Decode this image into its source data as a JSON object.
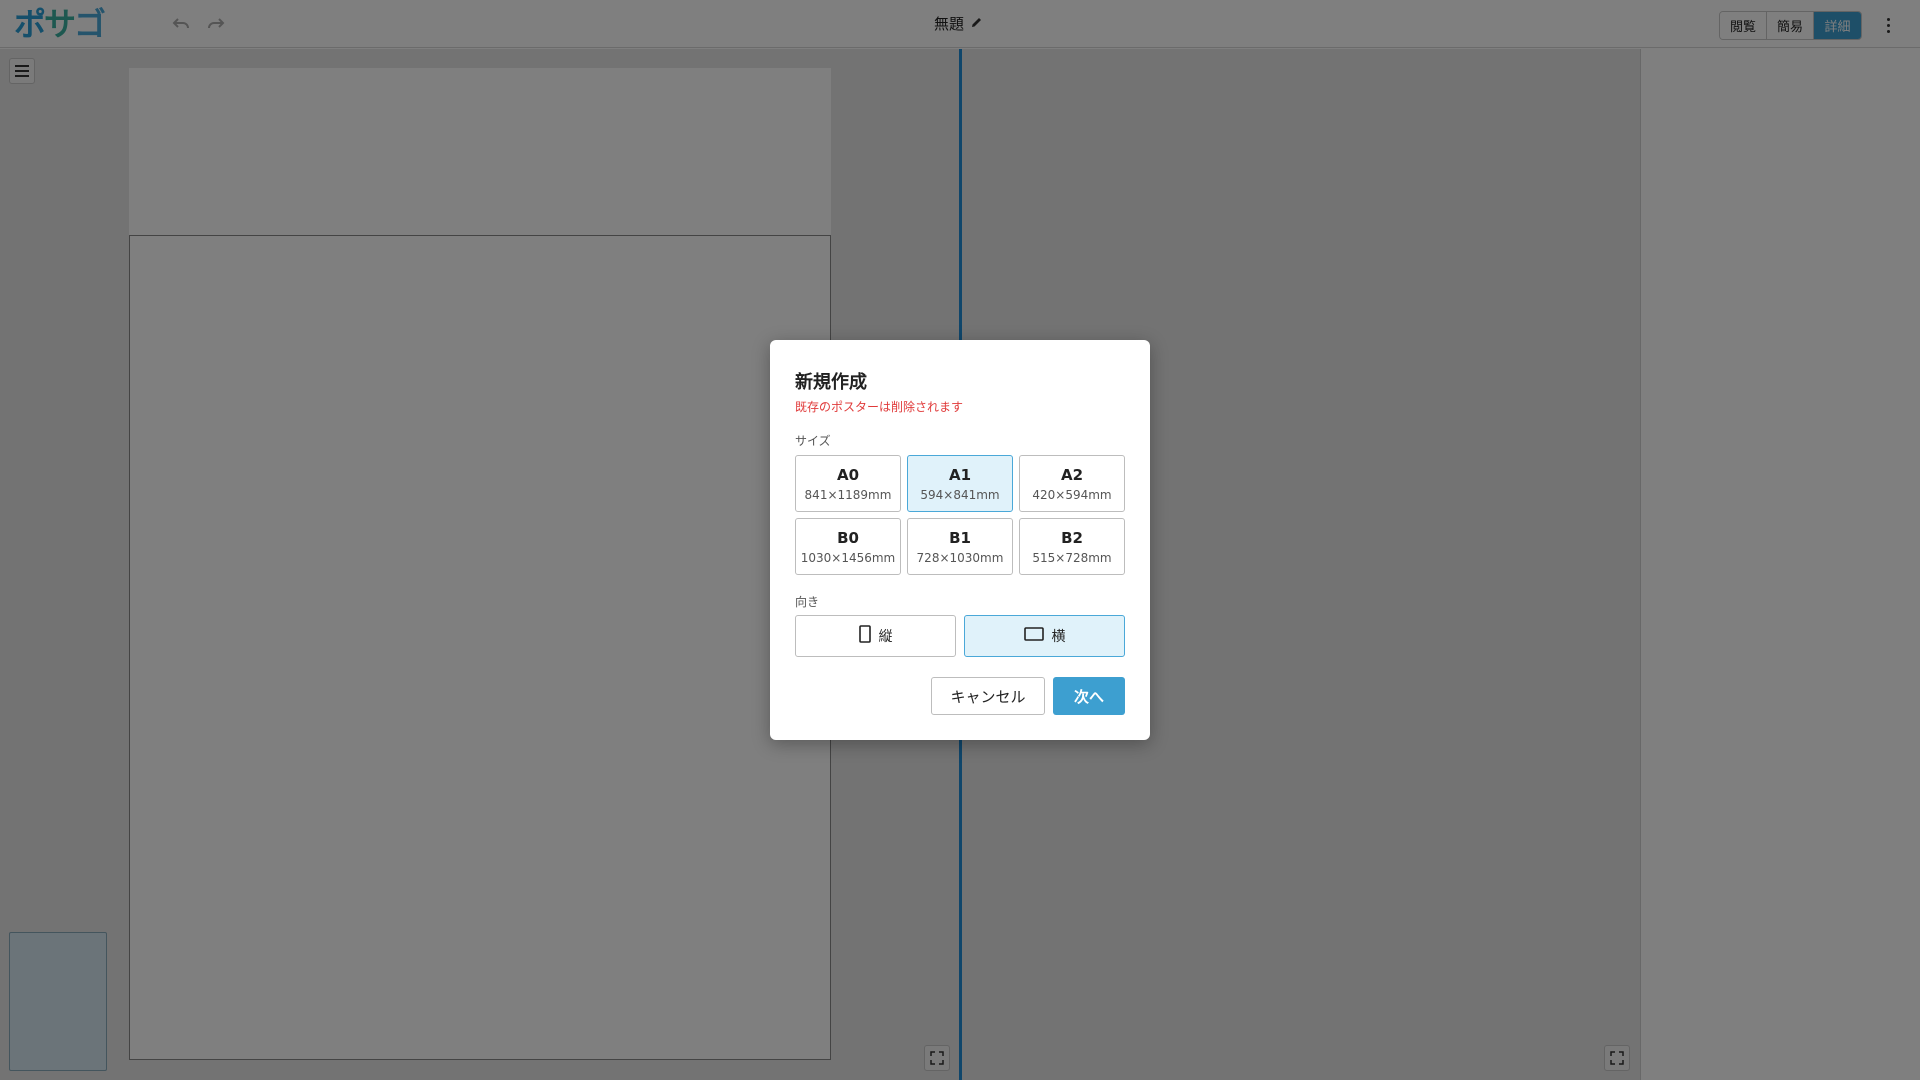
{
  "app": {
    "logo_text": "ポサゴ",
    "logo_colors": [
      "#2a9fd6",
      "#3ab0a0",
      "#4aa8d8"
    ],
    "document_title": "無題",
    "icons": {
      "undo": "undo-icon",
      "redo": "redo-icon",
      "edit": "pencil-icon",
      "more": "kebab-menu-icon",
      "menu": "hamburger-icon",
      "fullscreen": "fullscreen-icon"
    },
    "modes": [
      {
        "label": "閲覧",
        "active": false
      },
      {
        "label": "簡易",
        "active": false
      },
      {
        "label": "詳細",
        "active": true
      }
    ],
    "accent_color": "#3d9fd0",
    "divider_color": "#1e8cd6"
  },
  "dialog": {
    "title": "新規作成",
    "warning": "既存のポスターは削除されます",
    "warning_color": "#e03a3a",
    "size_label": "サイズ",
    "sizes": [
      {
        "name": "A0",
        "dims": "841×1189mm",
        "selected": false
      },
      {
        "name": "A1",
        "dims": "594×841mm",
        "selected": true
      },
      {
        "name": "A2",
        "dims": "420×594mm",
        "selected": false
      },
      {
        "name": "B0",
        "dims": "1030×1456mm",
        "selected": false
      },
      {
        "name": "B1",
        "dims": "728×1030mm",
        "selected": false
      },
      {
        "name": "B2",
        "dims": "515×728mm",
        "selected": false
      }
    ],
    "orientation_label": "向き",
    "orientations": [
      {
        "label": "縦",
        "icon": "portrait-icon",
        "selected": false
      },
      {
        "label": "横",
        "icon": "landscape-icon",
        "selected": true
      }
    ],
    "cancel_label": "キャンセル",
    "next_label": "次へ"
  }
}
